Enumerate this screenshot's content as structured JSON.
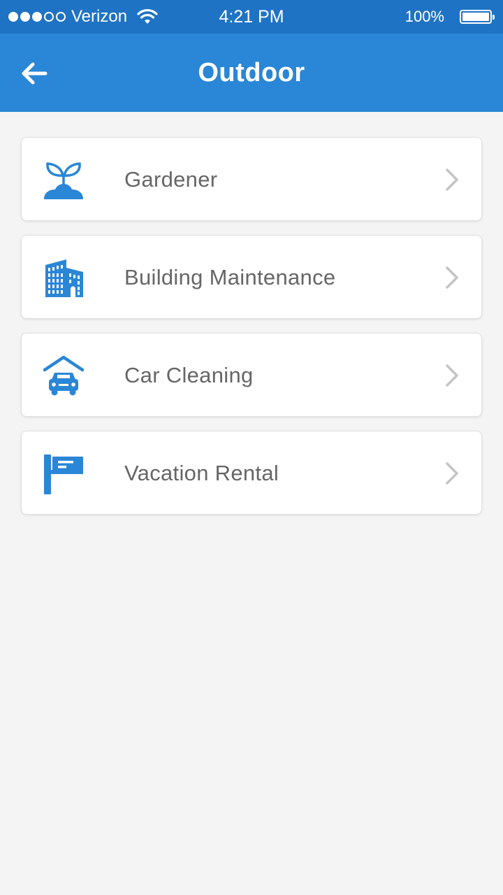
{
  "status_bar": {
    "carrier": "Verizon",
    "signal_bars_filled": 3,
    "signal_bars_total": 5,
    "time": "4:21 PM",
    "battery_percent": "100%"
  },
  "nav": {
    "title": "Outdoor",
    "back_icon": "arrow-left-icon"
  },
  "colors": {
    "status_bar": "#1f73c4",
    "nav_bar": "#2a86d6",
    "icon_blue": "#2a86d6",
    "label_text": "#666666",
    "chevron": "#c4c4c4",
    "background": "#f4f4f4"
  },
  "items": [
    {
      "label": "Gardener",
      "icon": "plant-sprout-icon"
    },
    {
      "label": "Building Maintenance",
      "icon": "building-icon"
    },
    {
      "label": "Car Cleaning",
      "icon": "car-garage-icon"
    },
    {
      "label": "Vacation Rental",
      "icon": "signboard-icon"
    }
  ]
}
